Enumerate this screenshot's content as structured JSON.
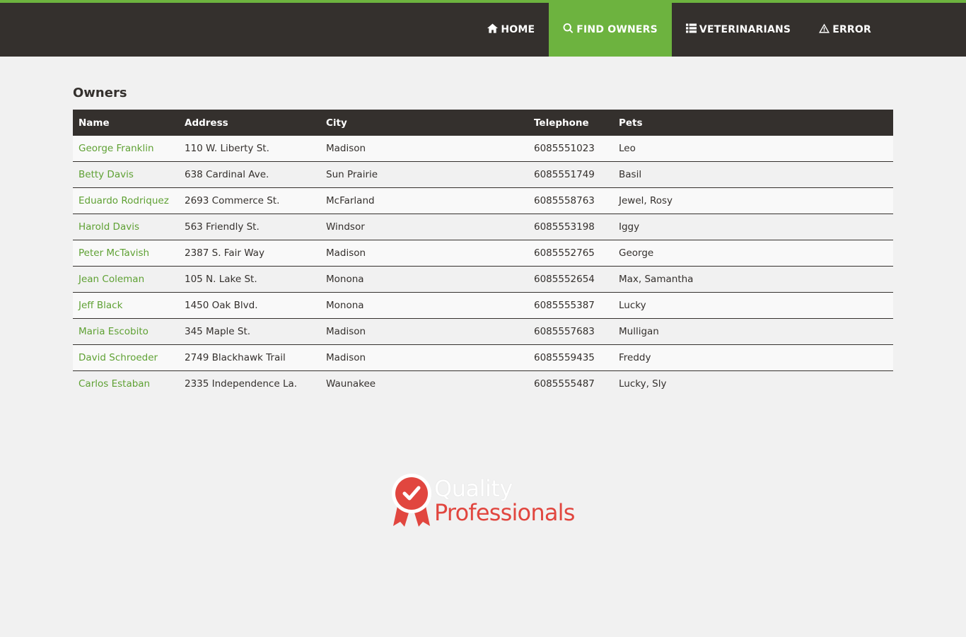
{
  "nav": {
    "items": [
      {
        "label": "HOME",
        "icon": "home-icon"
      },
      {
        "label": "FIND OWNERS",
        "icon": "search-icon",
        "active": true
      },
      {
        "label": "VETERINARIANS",
        "icon": "list-icon"
      },
      {
        "label": "ERROR",
        "icon": "warning-icon"
      }
    ]
  },
  "page": {
    "title": "Owners"
  },
  "table": {
    "headers": [
      "Name",
      "Address",
      "City",
      "Telephone",
      "Pets"
    ],
    "rows": [
      [
        "George Franklin",
        "110 W. Liberty St.",
        "Madison",
        "6085551023",
        "Leo"
      ],
      [
        "Betty Davis",
        "638 Cardinal Ave.",
        "Sun Prairie",
        "6085551749",
        "Basil"
      ],
      [
        "Eduardo Rodriquez",
        "2693 Commerce St.",
        "McFarland",
        "6085558763",
        "Jewel, Rosy"
      ],
      [
        "Harold Davis",
        "563 Friendly St.",
        "Windsor",
        "6085553198",
        "Iggy"
      ],
      [
        "Peter McTavish",
        "2387 S. Fair Way",
        "Madison",
        "6085552765",
        "George"
      ],
      [
        "Jean Coleman",
        "105 N. Lake St.",
        "Monona",
        "6085552654",
        "Max, Samantha"
      ],
      [
        "Jeff Black",
        "1450 Oak Blvd.",
        "Monona",
        "6085555387",
        "Lucky"
      ],
      [
        "Maria Escobito",
        "345 Maple St.",
        "Madison",
        "6085557683",
        "Mulligan"
      ],
      [
        "David Schroeder",
        "2749 Blackhawk Trail",
        "Madison",
        "6085559435",
        "Freddy"
      ],
      [
        "Carlos Estaban",
        "2335 Independence La.",
        "Waunakee",
        "6085555487",
        "Lucky, Sly"
      ]
    ]
  },
  "footer": {
    "logo_line1": "Quality",
    "logo_line2": "Professionals",
    "logo_icon": "ribbon-check-icon"
  },
  "colors": {
    "accent": "#6db33f",
    "dark": "#34302d",
    "link": "#5fa134",
    "logo_red": "#e1463f"
  }
}
